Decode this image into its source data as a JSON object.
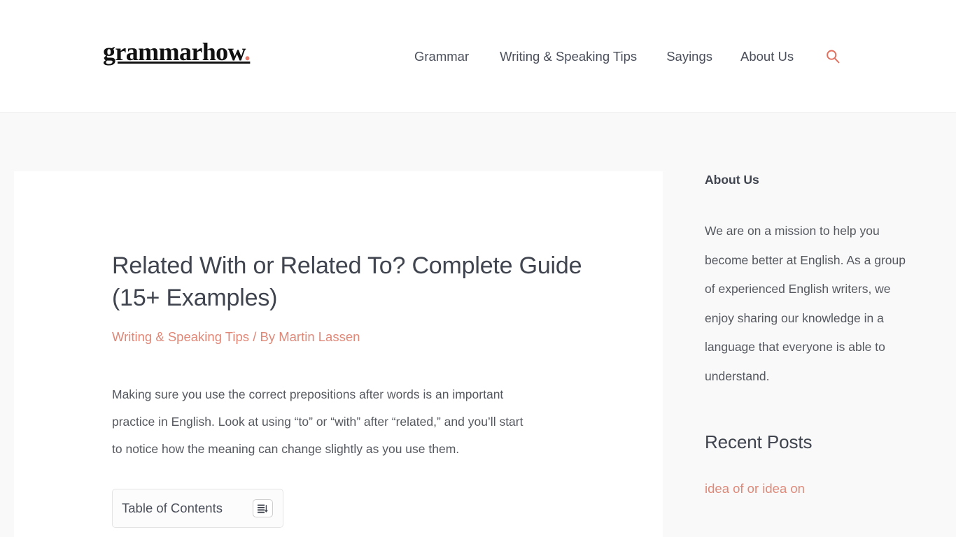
{
  "header": {
    "logo_text": "grammarhow",
    "logo_dot": ".",
    "nav": [
      {
        "label": "Grammar",
        "name": "nav-grammar"
      },
      {
        "label": "Writing & Speaking Tips",
        "name": "nav-writing-speaking-tips"
      },
      {
        "label": "Sayings",
        "name": "nav-sayings"
      },
      {
        "label": "About Us",
        "name": "nav-about-us"
      }
    ],
    "search_icon": "search-icon"
  },
  "article": {
    "title": "Related With or Related To? Complete Guide (15+ Examples)",
    "category": "Writing & Speaking Tips",
    "meta_separator": "/ By",
    "author": "Martin Lassen",
    "intro": "Making sure you use the correct prepositions after words is an important practice in English. Look at using “to” or “with” after “related,” and you’ll start to notice how the meaning can change slightly as you use them.",
    "toc_title": "Table of Contents",
    "toc_toggle_icon": "toc-list-toggle-icon"
  },
  "sidebar": {
    "about_title": "About Us",
    "about_text": "We are on a mission to help you become better at English. As a group of experienced English writers, we enjoy sharing our knowledge in a language that everyone is able to understand.",
    "recent_title": "Recent Posts",
    "recent_posts": [
      {
        "label": "idea of or idea on"
      }
    ]
  },
  "colors": {
    "accent": "#e08878",
    "logo_dot": "#e8796b",
    "text": "#4a4f5a",
    "heading": "#3f444e",
    "page_bg": "#f9f9f9",
    "card_bg": "#ffffff"
  }
}
